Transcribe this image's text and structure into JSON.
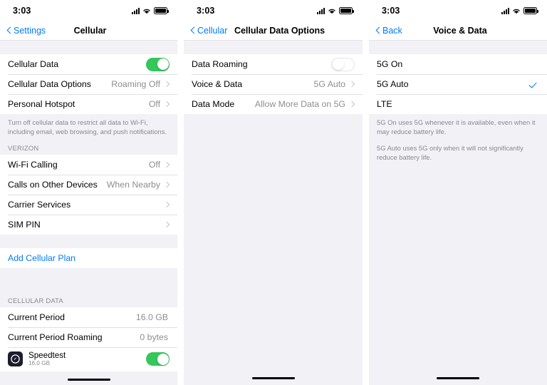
{
  "status_bar": {
    "time": "3:03",
    "icons": [
      "cellular-signal-icon",
      "wifi-icon",
      "battery-icon"
    ]
  },
  "screens": [
    {
      "id": "cellular",
      "nav": {
        "back_label": "Settings",
        "title": "Cellular",
        "back_icon": "chevron-left-icon"
      },
      "sections": [
        {
          "rows": [
            {
              "label": "Cellular Data",
              "control": "toggle",
              "toggle_on": true
            },
            {
              "label": "Cellular Data Options",
              "value": "Roaming Off",
              "control": "chevron"
            },
            {
              "label": "Personal Hotspot",
              "value": "Off",
              "control": "chevron"
            }
          ]
        }
      ],
      "footnote": "Turn off cellular data to restrict all data to Wi-Fi, including email, web browsing, and push notifications.",
      "carrier_header": "VERIZON",
      "carrier_rows": [
        {
          "label": "Wi-Fi Calling",
          "value": "Off",
          "control": "chevron"
        },
        {
          "label": "Calls on Other Devices",
          "value": "When Nearby",
          "control": "chevron"
        },
        {
          "label": "Carrier Services",
          "value": "",
          "control": "chevron"
        },
        {
          "label": "SIM PIN",
          "value": "",
          "control": "chevron"
        }
      ],
      "add_plan_label": "Add Cellular Plan",
      "data_header": "CELLULAR DATA",
      "data_rows": [
        {
          "label": "Current Period",
          "value": "16.0 GB"
        },
        {
          "label": "Current Period Roaming",
          "value": "0 bytes"
        }
      ],
      "app_row": {
        "icon": "speedtest-app-icon",
        "name": "Speedtest",
        "sub": "16.0 GB",
        "toggle_on": true
      }
    },
    {
      "id": "cellular-data-options",
      "nav": {
        "back_label": "Cellular",
        "title": "Cellular Data Options",
        "back_icon": "chevron-left-icon"
      },
      "rows": [
        {
          "label": "Data Roaming",
          "control": "toggle",
          "toggle_on": false
        },
        {
          "label": "Voice & Data",
          "value": "5G Auto",
          "control": "chevron"
        },
        {
          "label": "Data Mode",
          "value": "Allow More Data on 5G",
          "control": "chevron"
        }
      ]
    },
    {
      "id": "voice-and-data",
      "nav": {
        "back_label": "Back",
        "title": "Voice & Data",
        "back_icon": "chevron-left-icon"
      },
      "options": [
        {
          "label": "5G On",
          "selected": false
        },
        {
          "label": "5G Auto",
          "selected": true
        },
        {
          "label": "LTE",
          "selected": false
        }
      ],
      "footnotes": [
        "5G On uses 5G whenever it is available, even when it may reduce battery life.",
        "5G Auto uses 5G only when it will not significantly reduce battery life."
      ]
    }
  ],
  "colors": {
    "accent_blue": "#007aff",
    "toggle_green": "#34c759",
    "background_gray": "#f1f1f6",
    "secondary_text": "#8e8e93"
  }
}
